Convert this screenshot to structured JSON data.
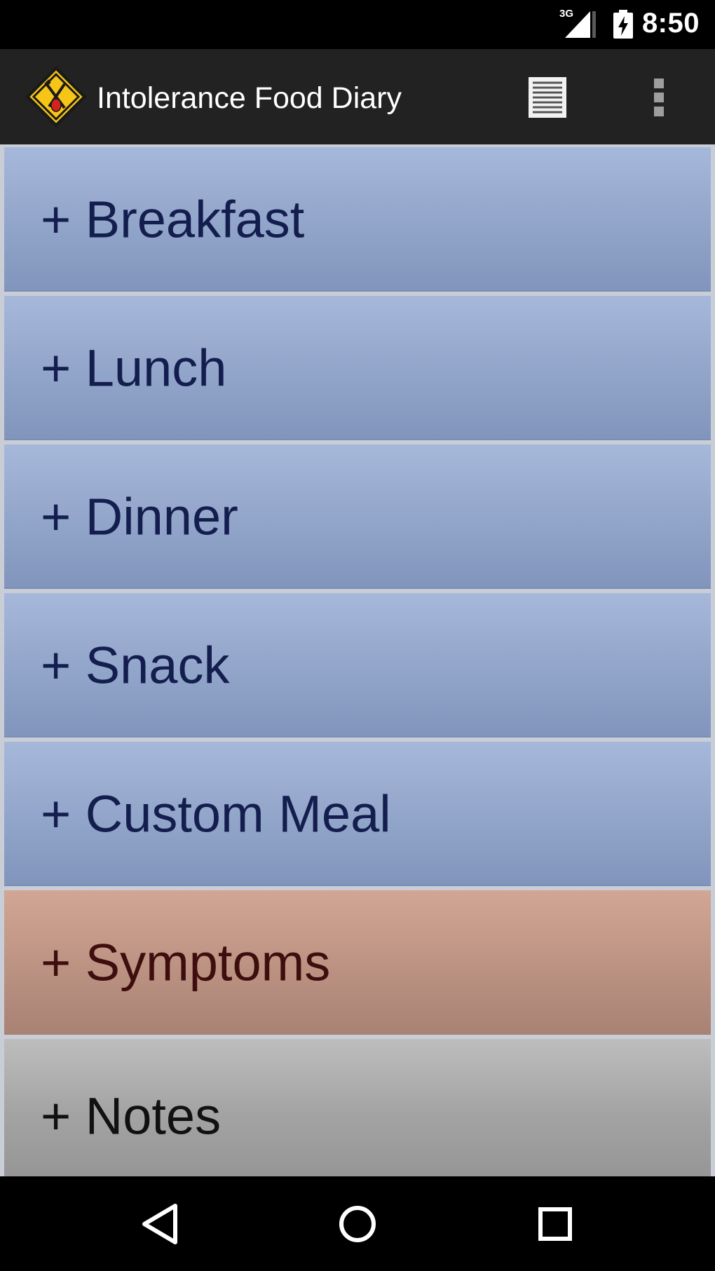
{
  "status_bar": {
    "network_label": "3G",
    "time": "8:50",
    "icons": [
      "signal-3g-icon",
      "battery-charging-icon"
    ]
  },
  "action_bar": {
    "title": "Intolerance Food Diary",
    "logo_icon": "food-diary-diamond-logo",
    "actions": [
      "list-view-icon",
      "overflow-menu-icon"
    ]
  },
  "entries": [
    {
      "label": "+ Breakfast",
      "kind": "meal"
    },
    {
      "label": "+ Lunch",
      "kind": "meal"
    },
    {
      "label": "+ Dinner",
      "kind": "meal"
    },
    {
      "label": "+ Snack",
      "kind": "meal"
    },
    {
      "label": "+ Custom Meal",
      "kind": "meal"
    },
    {
      "label": "+ Symptoms",
      "kind": "symptom"
    },
    {
      "label": "+ Notes",
      "kind": "note"
    }
  ],
  "nav_bar": {
    "icons": [
      "back-icon",
      "home-icon",
      "recent-apps-icon"
    ]
  },
  "colors": {
    "meal_bg": "#91a4c9",
    "meal_text": "#141e4e",
    "symptom_bg": "#bb9282",
    "symptom_text": "#3e0e0e",
    "note_bg": "#a3a3a3",
    "logo_yellow": "#f7c516"
  }
}
